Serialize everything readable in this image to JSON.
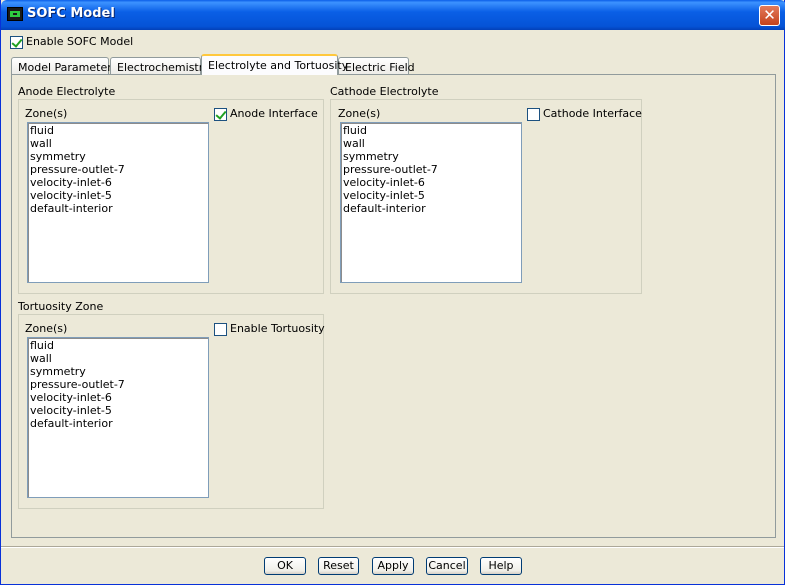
{
  "window": {
    "title": "SOFC Model"
  },
  "enable_sofc": {
    "label": "Enable SOFC Model",
    "checked": true
  },
  "tabs": [
    {
      "label": "Model Parameters",
      "active": false
    },
    {
      "label": "Electrochemistry",
      "active": false
    },
    {
      "label": "Electrolyte and Tortuosity",
      "active": true
    },
    {
      "label": "Electric Field",
      "active": false
    }
  ],
  "anode": {
    "title": "Anode Electrolyte",
    "zones_label": "Zone(s)",
    "zones": [
      "fluid",
      "wall",
      "symmetry",
      "pressure-outlet-7",
      "velocity-inlet-6",
      "velocity-inlet-5",
      "default-interior"
    ],
    "interface_label": "Anode Interface",
    "interface_checked": true
  },
  "cathode": {
    "title": "Cathode Electrolyte",
    "zones_label": "Zone(s)",
    "zones": [
      "fluid",
      "wall",
      "symmetry",
      "pressure-outlet-7",
      "velocity-inlet-6",
      "velocity-inlet-5",
      "default-interior"
    ],
    "interface_label": "Cathode Interface",
    "interface_checked": false
  },
  "tortuosity": {
    "title": "Tortuosity Zone",
    "zones_label": "Zone(s)",
    "zones": [
      "fluid",
      "wall",
      "symmetry",
      "pressure-outlet-7",
      "velocity-inlet-6",
      "velocity-inlet-5",
      "default-interior"
    ],
    "enable_label": "Enable Tortuosity",
    "enable_checked": false
  },
  "buttons": {
    "ok": "OK",
    "reset": "Reset",
    "apply": "Apply",
    "cancel": "Cancel",
    "help": "Help"
  },
  "colors": {
    "titlebar": "#0553d6",
    "face": "#ece9d8",
    "active_tab_accent": "#ffc83c",
    "close": "#c5431c"
  },
  "icons": {
    "app": "sofc-app-icon",
    "close": "close-icon"
  }
}
